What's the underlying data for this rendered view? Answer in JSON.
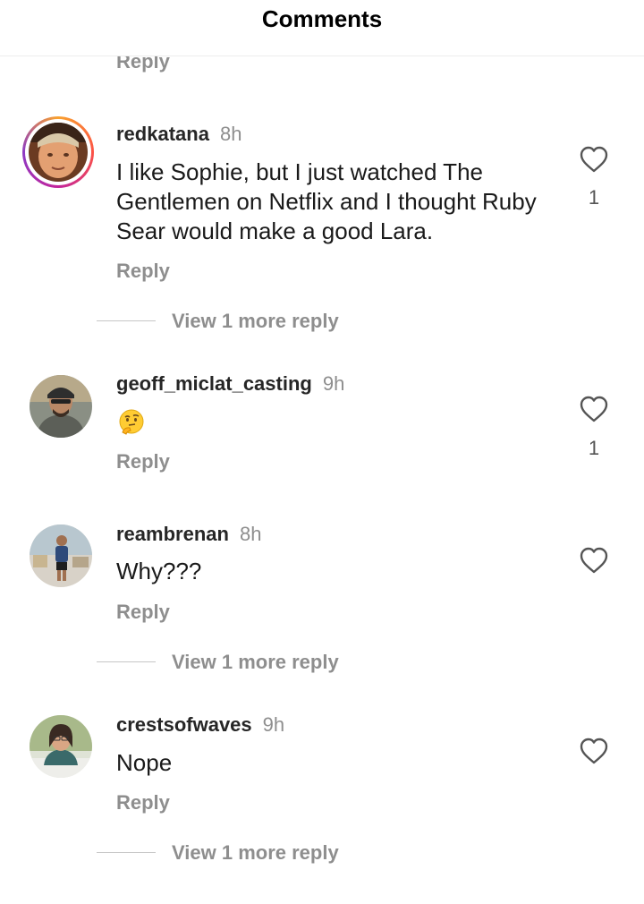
{
  "header": {
    "title": "Comments"
  },
  "clipped_reply_label": "Reply",
  "comments": [
    {
      "username": "redkatana",
      "time": "8h",
      "text": "I like Sophie, but I just watched The Gentlemen on Netflix and I thought Ruby Sear would make a good Lara.",
      "reply_label": "Reply",
      "likes": "1",
      "view_more": "View 1 more reply",
      "has_story_ring": true
    },
    {
      "username": "geoff_miclat_casting",
      "time": "9h",
      "text": "🤔",
      "reply_label": "Reply",
      "likes": "1"
    },
    {
      "username": "reambrenan",
      "time": "8h",
      "text": "Why???",
      "reply_label": "Reply",
      "view_more": "View 1 more reply"
    },
    {
      "username": "crestsofwaves",
      "time": "9h",
      "text": "Nope",
      "reply_label": "Reply",
      "view_more": "View 1 more reply"
    }
  ],
  "icons": {
    "like": "heart-outline-icon",
    "thinking_emoji": "thinking-face-icon"
  },
  "colors": {
    "accent_gray": "#8e8e8e",
    "story_ring": [
      "#f9a12e",
      "#fc5245",
      "#c3249b"
    ]
  }
}
